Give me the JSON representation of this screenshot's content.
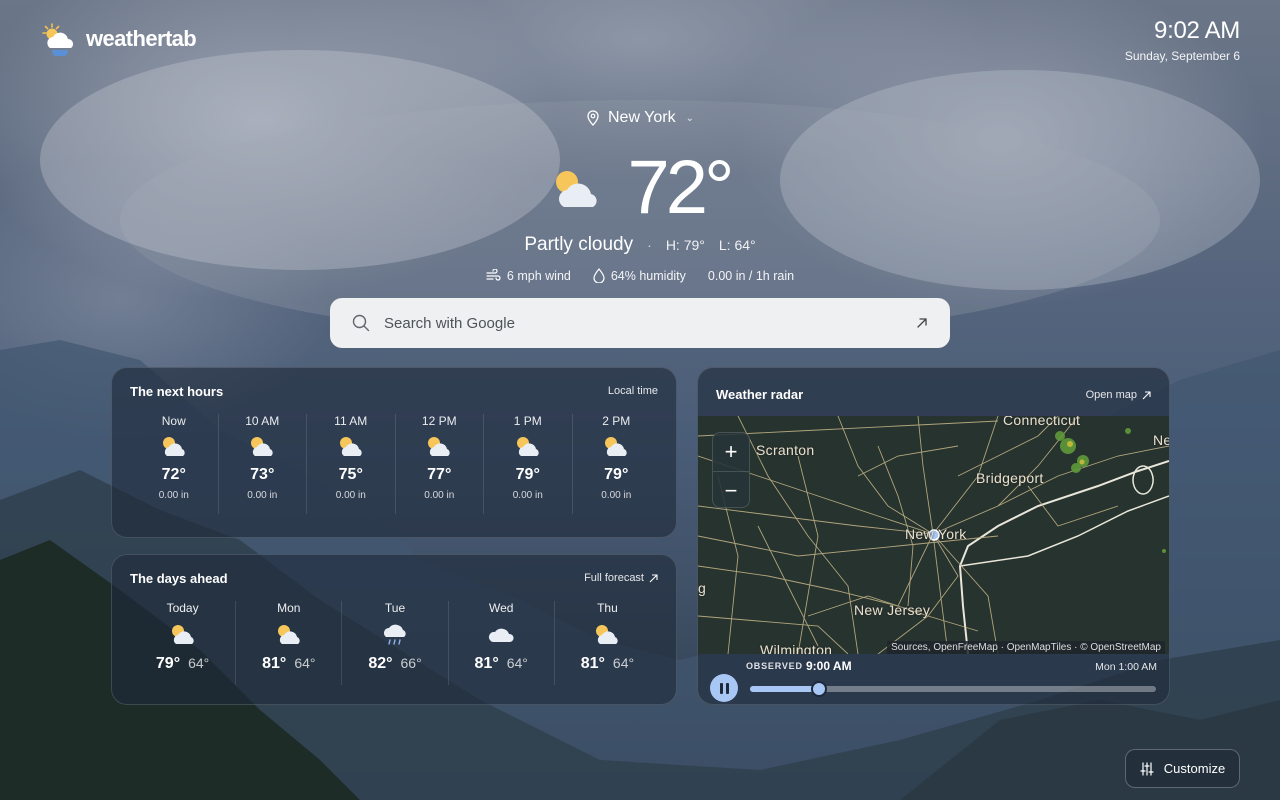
{
  "app": {
    "logo_text": "weathertab"
  },
  "clock": {
    "time": "9:02 AM",
    "date": "Sunday, September 6"
  },
  "location": {
    "name": "New York"
  },
  "current": {
    "temp": "72°",
    "condition": "Partly cloudy",
    "high": "H: 79°",
    "low": "L: 64°",
    "wind": "6 mph wind",
    "humidity": "64% humidity",
    "rain": "0.00 in / 1h rain"
  },
  "search": {
    "placeholder": "Search with Google"
  },
  "next_hours": {
    "title": "The next hours",
    "link": "Local time",
    "items": [
      {
        "label": "Now",
        "temp": "72°",
        "rain": "0.00 in",
        "icon": "partly-cloudy-icon"
      },
      {
        "label": "10 AM",
        "temp": "73°",
        "rain": "0.00 in",
        "icon": "partly-cloudy-icon"
      },
      {
        "label": "11 AM",
        "temp": "75°",
        "rain": "0.00 in",
        "icon": "partly-cloudy-icon"
      },
      {
        "label": "12 PM",
        "temp": "77°",
        "rain": "0.00 in",
        "icon": "partly-cloudy-icon"
      },
      {
        "label": "1 PM",
        "temp": "79°",
        "rain": "0.00 in",
        "icon": "partly-cloudy-icon"
      },
      {
        "label": "2 PM",
        "temp": "79°",
        "rain": "0.00 in",
        "icon": "partly-cloudy-icon"
      }
    ]
  },
  "days_ahead": {
    "title": "The days ahead",
    "link": "Full forecast",
    "items": [
      {
        "label": "Today",
        "high": "79°",
        "low": "64°",
        "icon": "partly-cloudy-icon"
      },
      {
        "label": "Mon",
        "high": "81°",
        "low": "64°",
        "icon": "partly-cloudy-icon"
      },
      {
        "label": "Tue",
        "high": "82°",
        "low": "66°",
        "icon": "rain-icon"
      },
      {
        "label": "Wed",
        "high": "81°",
        "low": "64°",
        "icon": "cloud-icon"
      },
      {
        "label": "Thu",
        "high": "81°",
        "low": "64°",
        "icon": "partly-cloudy-icon"
      }
    ]
  },
  "radar": {
    "title": "Weather radar",
    "link": "Open map",
    "map_labels": [
      "Connecticut",
      "Ne",
      "Scranton",
      "Bridgeport",
      "New York",
      "g",
      "New Jersey",
      "Wilmington"
    ],
    "attribution": "Sources, OpenFreeMap · OpenMapTiles · © OpenStreetMap",
    "zoom_in": "+",
    "zoom_out": "−",
    "observed_tag": "OBSERVED",
    "observed_time": "9:00 AM",
    "end_time": "Mon 1:00 AM",
    "timeline_progress": 0.17
  },
  "customize": {
    "label": "Customize"
  },
  "colors": {
    "accent": "#a9c7f5",
    "sun": "#f7c65a",
    "search_bg": "#eef0f2"
  }
}
